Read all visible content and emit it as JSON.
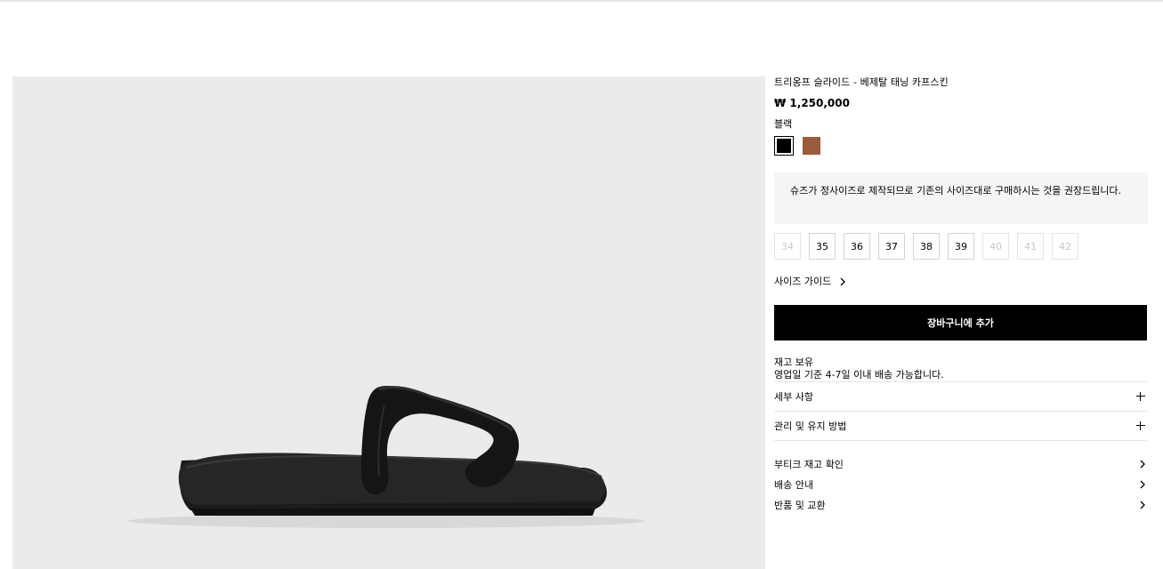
{
  "product": {
    "title": "트리옹프 슬라이드 - 베제탈 태닝 카프스킨",
    "price": "₩ 1,250,000",
    "color_label": "블랙",
    "swatches": [
      {
        "name": "black",
        "color": "#000000",
        "selected": true
      },
      {
        "name": "tan",
        "color": "#9c5a3c",
        "selected": false
      }
    ],
    "size_notice": "슈즈가 정사이즈로 제작되므로 기존의 사이즈대로 구매하시는 것을 권장드립니다.",
    "sizes": [
      {
        "label": "34",
        "available": false
      },
      {
        "label": "35",
        "available": true
      },
      {
        "label": "36",
        "available": true
      },
      {
        "label": "37",
        "available": true
      },
      {
        "label": "38",
        "available": true
      },
      {
        "label": "39",
        "available": true
      },
      {
        "label": "40",
        "available": false
      },
      {
        "label": "41",
        "available": false
      },
      {
        "label": "42",
        "available": false
      }
    ],
    "size_guide": "사이즈 가이드",
    "add_to_cart": "장바구니에 추가",
    "stock_status": "재고 보유",
    "delivery_note": "영업일 기준 4-7일 이내 배송 가능합니다.",
    "accordions": [
      {
        "label": "세부 사항"
      },
      {
        "label": "관리 및 유지 방법"
      }
    ],
    "links": [
      {
        "label": "부티크 재고 확인"
      },
      {
        "label": "배송 안내"
      },
      {
        "label": "반품 및 교환"
      }
    ]
  },
  "colors": {
    "image_bg": "#ebebeb",
    "button_bg": "#000000",
    "notice_bg": "#f5f5f5"
  }
}
